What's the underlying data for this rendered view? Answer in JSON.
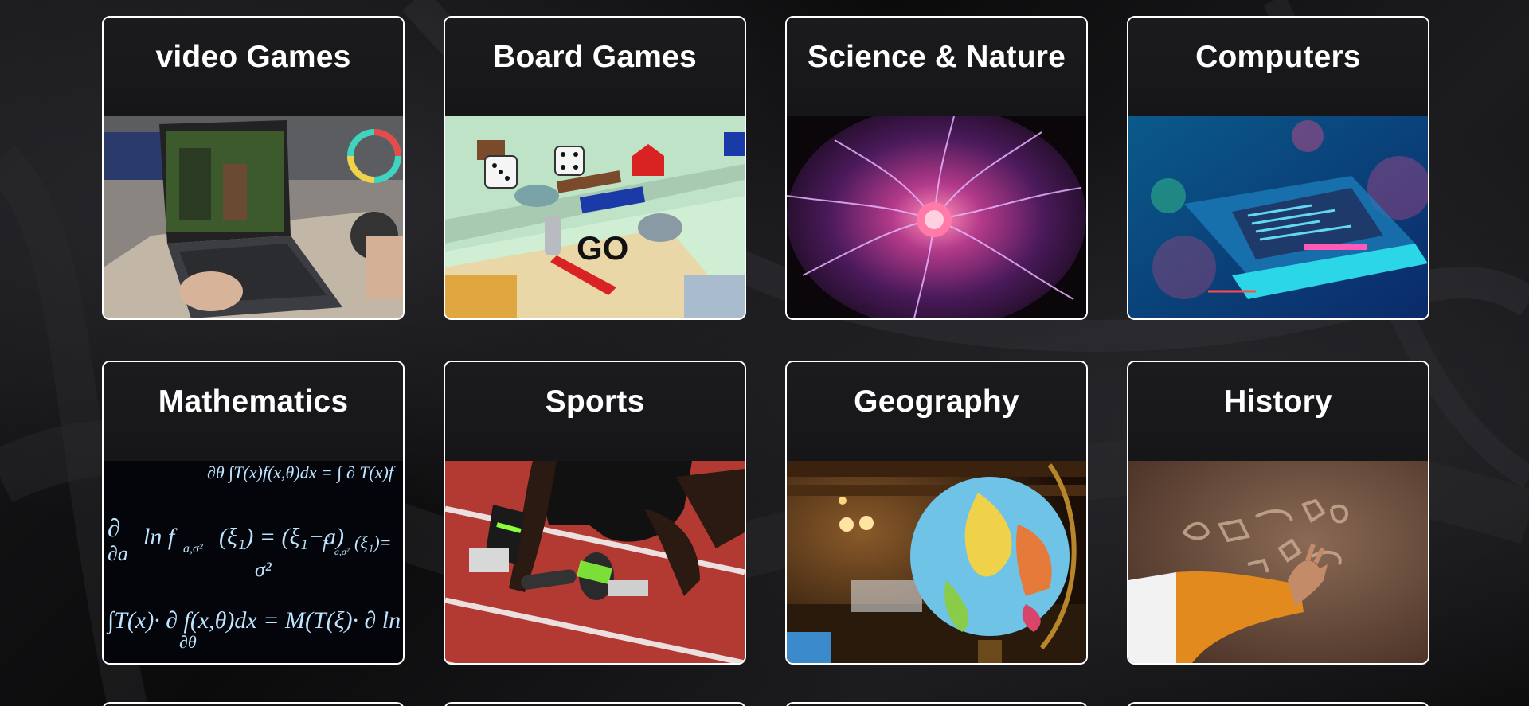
{
  "categories": [
    {
      "title": "video Games",
      "image": "laptop-gaming-image"
    },
    {
      "title": "Board Games",
      "image": "monopoly-board-image"
    },
    {
      "title": "Science & Nature",
      "image": "plasma-ball-image"
    },
    {
      "title": "Computers",
      "image": "holographic-laptop-image"
    },
    {
      "title": "Mathematics",
      "image": "math-equations-image"
    },
    {
      "title": "Sports",
      "image": "sprinter-track-image"
    },
    {
      "title": "Geography",
      "image": "globe-image"
    },
    {
      "title": "History",
      "image": "cave-petroglyph-image"
    }
  ],
  "colors": {
    "card_border": "#ffffff",
    "title_text": "#ffffff",
    "background": "#0e0e10"
  }
}
